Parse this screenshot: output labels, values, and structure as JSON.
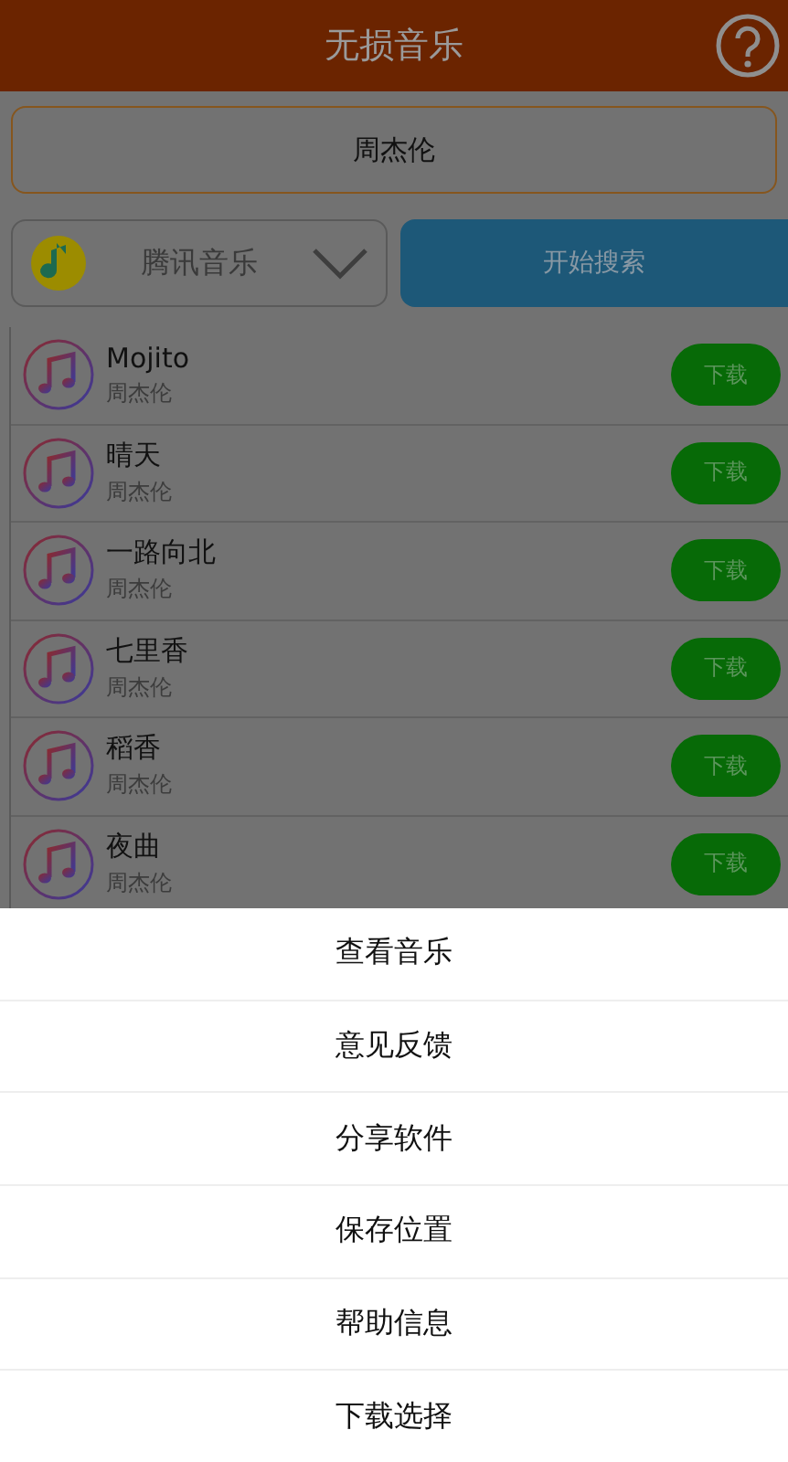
{
  "header": {
    "title": "无损音乐"
  },
  "search": {
    "value": "周杰伦"
  },
  "source": {
    "label": "腾讯音乐"
  },
  "search_button": {
    "label": "开始搜索"
  },
  "songs": [
    {
      "title": "Mojito",
      "artist": "周杰伦",
      "action": "下载"
    },
    {
      "title": "晴天",
      "artist": "周杰伦",
      "action": "下载"
    },
    {
      "title": "一路向北",
      "artist": "周杰伦",
      "action": "下载"
    },
    {
      "title": "七里香",
      "artist": "周杰伦",
      "action": "下载"
    },
    {
      "title": "稻香",
      "artist": "周杰伦",
      "action": "下载"
    },
    {
      "title": "夜曲",
      "artist": "周杰伦",
      "action": "下载"
    }
  ],
  "menu": [
    "查看音乐",
    "意见反馈",
    "分享软件",
    "保存位置",
    "帮助信息",
    "下载选择"
  ]
}
